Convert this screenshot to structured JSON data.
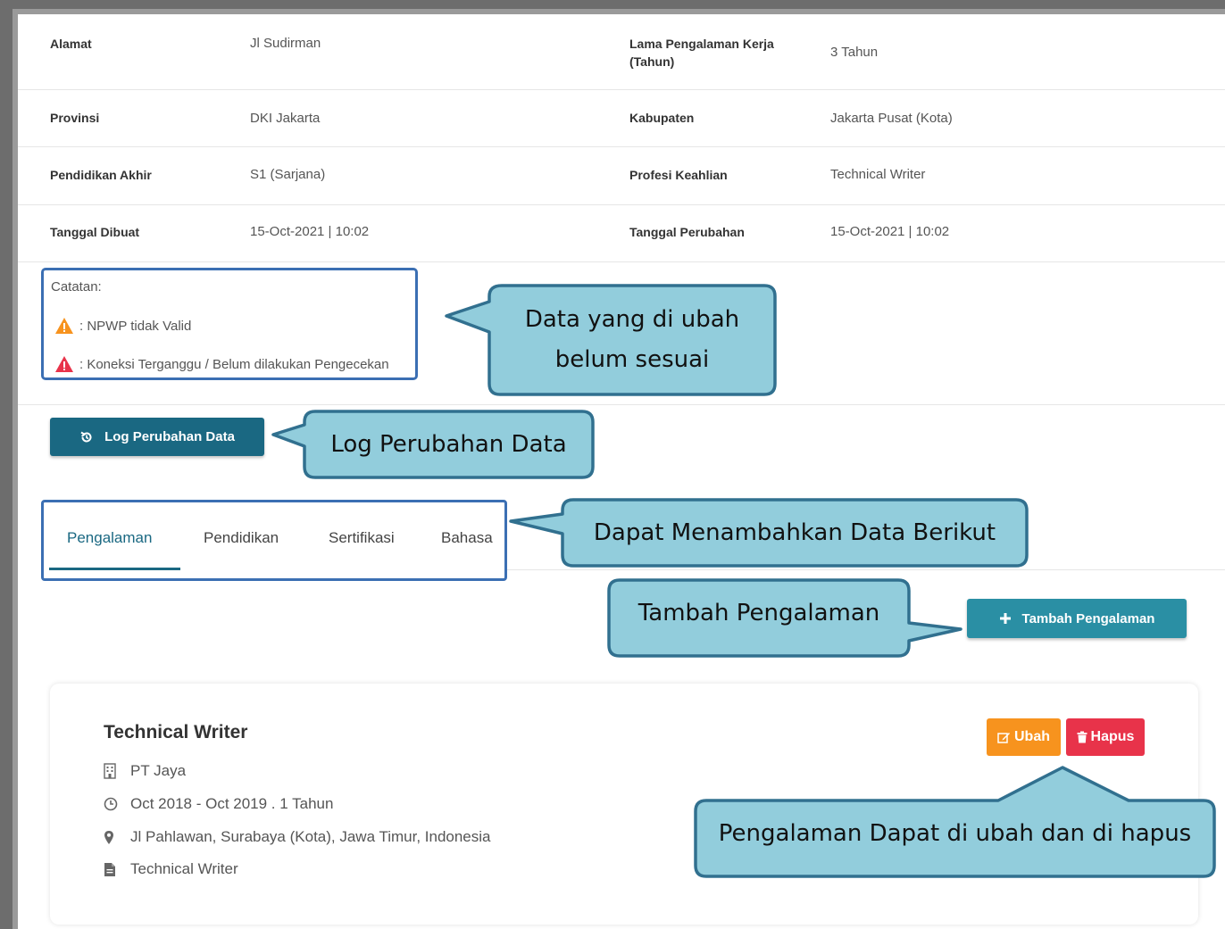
{
  "info": {
    "rows": [
      {
        "l1": "Alamat",
        "v1": "Jl Sudirman",
        "l2a": "Lama Pengalaman Kerja",
        "l2b": "(Tahun)",
        "v2": "3 Tahun"
      },
      {
        "l1": "Provinsi",
        "v1": "DKI Jakarta",
        "l2": "Kabupaten",
        "v2": "Jakarta Pusat (Kota)"
      },
      {
        "l1": "Pendidikan Akhir",
        "v1": "S1 (Sarjana)",
        "l2": "Profesi Keahlian",
        "v2": "Technical Writer"
      },
      {
        "l1": "Tanggal Dibuat",
        "v1": "15-Oct-2021 | 10:02",
        "l2": "Tanggal Perubahan",
        "v2": "15-Oct-2021 | 10:02"
      }
    ]
  },
  "notes": {
    "title": "Catatan:",
    "items": [
      {
        "text": ": NPWP tidak Valid",
        "color": "#f7931e",
        "icon": "warning-icon"
      },
      {
        "text": ": Koneksi Terganggu / Belum dilakukan Pengecekan",
        "color": "#e8334a",
        "icon": "warning-icon"
      }
    ]
  },
  "log_button": {
    "label": "Log Perubahan Data",
    "icon": "history-icon"
  },
  "tabs": [
    {
      "label": "Pengalaman",
      "active": true
    },
    {
      "label": "Pendidikan"
    },
    {
      "label": "Sertifikasi"
    },
    {
      "label": "Bahasa"
    }
  ],
  "add_button": {
    "label": "Tambah Pengalaman",
    "icon": "plus-icon"
  },
  "experience": {
    "title": "Technical Writer",
    "company": "PT Jaya",
    "period": "Oct 2018 - Oct 2019 . 1 Tahun",
    "location": "Jl Pahlawan, Surabaya (Kota), Jawa Timur, Indonesia",
    "description": "Technical Writer",
    "edit_label": "Ubah",
    "delete_label": "Hapus"
  },
  "callouts": {
    "data": [
      "Data yang di ubah",
      "belum sesuai"
    ],
    "log": "Log Perubahan Data",
    "tabs": "Dapat Menambahkan Data Berikut",
    "add": "Tambah Pengalaman",
    "edit": "Pengalaman Dapat di ubah dan di hapus"
  },
  "colors": {
    "primary": "#1a6882",
    "callout_fill": "#92cddc",
    "callout_border": "#31708f",
    "highlight": "#3b6fb3"
  }
}
